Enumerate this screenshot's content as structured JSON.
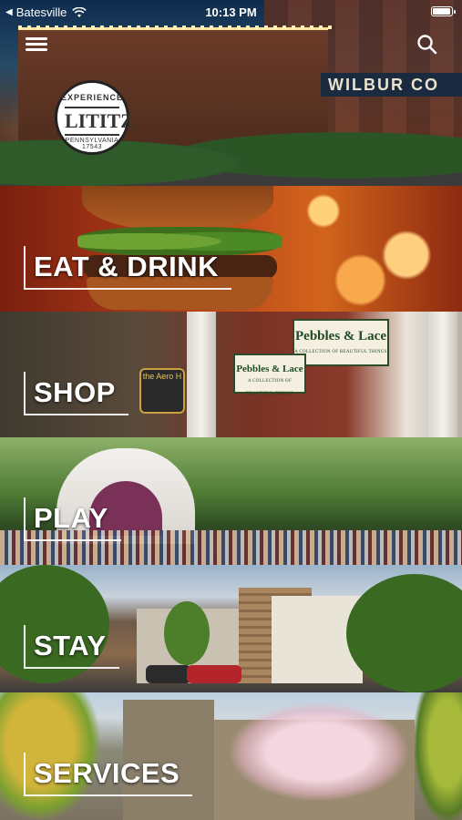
{
  "status_bar": {
    "carrier": "Batesville",
    "time": "10:13 PM",
    "battery_level": 1.0
  },
  "header": {
    "menu_icon": "hamburger-menu-icon",
    "search_icon": "search-icon"
  },
  "hero": {
    "logo": {
      "top_text": "EXPERIENCE",
      "name": "LITITZ",
      "bottom_text": "PENNSYLVANIA 17543"
    },
    "sign_text": "WILBUR CO"
  },
  "categories": [
    {
      "label": "EAT & DRINK"
    },
    {
      "label": "SHOP"
    },
    {
      "label": "PLAY"
    },
    {
      "label": "STAY"
    },
    {
      "label": "SERVICES"
    }
  ],
  "shop_signs": {
    "primary": "Pebbles & Lace",
    "tagline": "A COLLECTION OF BEAUTIFUL THINGS",
    "hanging": "the Aero H"
  },
  "colors": {
    "label_text": "#ffffff",
    "label_border": "#ffffff"
  }
}
